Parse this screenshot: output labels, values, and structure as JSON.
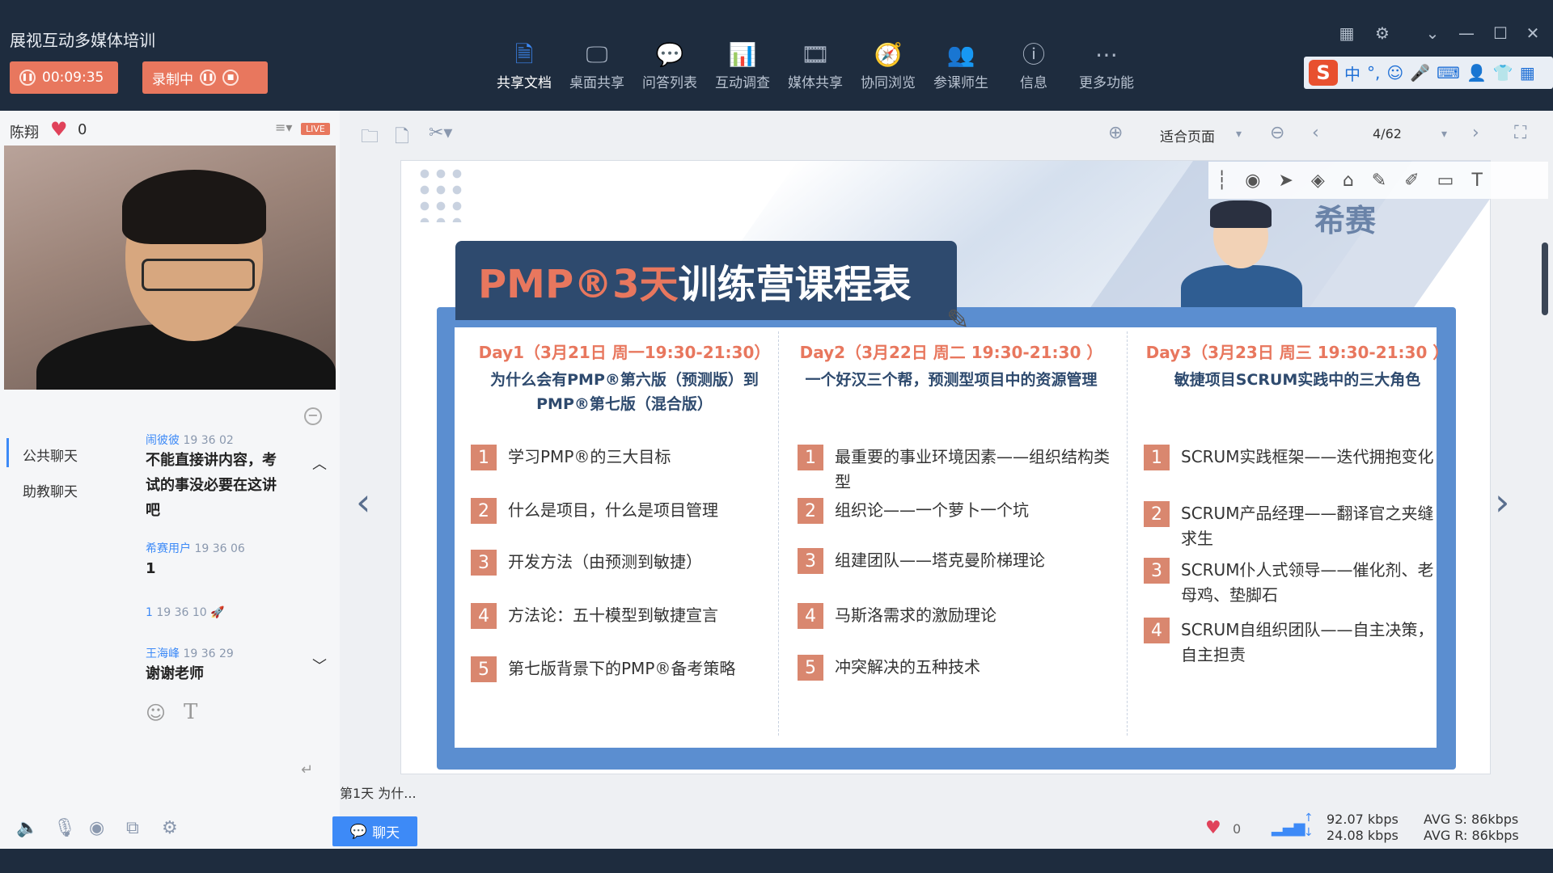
{
  "app": {
    "title": "展视互动多媒体培训"
  },
  "timer": {
    "elapsed": "00:09:35"
  },
  "recording": {
    "label": "录制中"
  },
  "toolbar": {
    "items": [
      {
        "label": "共享文档",
        "icon": "document-icon",
        "glyph": "🗎",
        "active": true
      },
      {
        "label": "桌面共享",
        "icon": "desktop-icon",
        "glyph": "🖵",
        "active": false
      },
      {
        "label": "问答列表",
        "icon": "qa-icon",
        "glyph": "💬",
        "active": false
      },
      {
        "label": "互动调查",
        "icon": "bar-chart-icon",
        "glyph": "📊",
        "active": false
      },
      {
        "label": "媒体共享",
        "icon": "film-icon",
        "glyph": "🎞",
        "active": false
      },
      {
        "label": "协同浏览",
        "icon": "compass-icon",
        "glyph": "🧭",
        "active": false
      },
      {
        "label": "参课师生",
        "icon": "people-icon",
        "glyph": "👥",
        "active": false
      },
      {
        "label": "信息",
        "icon": "info-icon",
        "glyph": "ⓘ",
        "active": false
      },
      {
        "label": "更多功能",
        "icon": "more-icon",
        "glyph": "⋯",
        "active": false
      }
    ]
  },
  "ime": {
    "logo": "S",
    "mode": "中"
  },
  "presenter": {
    "name": "陈翔",
    "likes": "0",
    "live": "LIVE"
  },
  "chat": {
    "tabs": [
      "公共聊天",
      "助教聊天"
    ],
    "messages": [
      {
        "name": "闹彼彼",
        "time": "19 36 02",
        "text": "不能直接讲内容，考试的事没必要在这讲吧"
      },
      {
        "name": "希赛用户",
        "time": "19 36 06",
        "text": "1"
      },
      {
        "name": "1",
        "time": "19 36 10",
        "text": ""
      },
      {
        "name": "王海峰",
        "time": "19 36 29",
        "text": "谢谢老师"
      }
    ],
    "send_button": "聊天"
  },
  "viewer": {
    "fit": "适合页面",
    "page": "4/62",
    "thumb": "第1天  为什..."
  },
  "slide": {
    "title_accent": "PMP®3天",
    "title_rest": "训练营课程表",
    "brand": "希赛",
    "days": [
      {
        "head": "Day1（3月21日 周一19:30-21:30）",
        "sub": "为什么会有PMP®第六版（预测版）到PMP®第七版（混合版）",
        "items": [
          "学习PMP®的三大目标",
          "什么是项目，什么是项目管理",
          "开发方法（由预测到敏捷）",
          "方法论：五十模型到敏捷宣言",
          "第七版背景下的PMP®备考策略"
        ]
      },
      {
        "head": "Day2（3月22日 周二 19:30-21:30 ）",
        "sub": "一个好汉三个帮，预测型项目中的资源管理",
        "items": [
          "最重要的事业环境因素——组织结构类型",
          "组织论——一个萝卜一个坑",
          "组建团队——塔克曼阶梯理论",
          "马斯洛需求的激励理论",
          "冲突解决的五种技术"
        ]
      },
      {
        "head": "Day3（3月23日 周三 19:30-21:30 ）",
        "sub": "敏捷项目SCRUM实践中的三大角色",
        "items": [
          "SCRUM实践框架——迭代拥抱变化",
          "SCRUM产品经理——翻译官之夹缝求生",
          "SCRUM仆人式领导——催化剂、老母鸡、垫脚石",
          "SCRUM自组织团队——自主决策，自主担责"
        ]
      }
    ]
  },
  "stats": {
    "likes": "0",
    "send_rate": "92.07 kbps",
    "recv_rate": "24.08 kbps",
    "avg_s": "AVG S: 86kbps",
    "avg_r": "AVG R: 86kbps"
  },
  "colors": {
    "topbar": "#1e2c3e",
    "accent": "#e8775e",
    "primary": "#3d8af7",
    "slide_navy": "#2e4a6e",
    "frame_blue": "#5b8ed0"
  }
}
